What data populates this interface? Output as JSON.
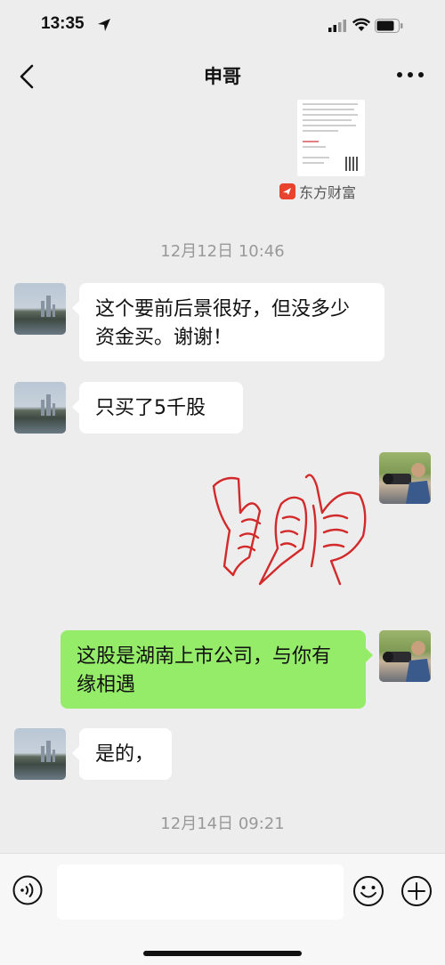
{
  "status_bar": {
    "time": "13:35"
  },
  "header": {
    "title": "申哥"
  },
  "shared_card": {
    "source": "东方财富"
  },
  "messages": [
    {
      "type": "timestamp",
      "text": "12月12日 10:46"
    },
    {
      "type": "text",
      "side": "left",
      "text": "这个要前后景很好，但没多少资金买。谢谢！"
    },
    {
      "type": "text",
      "side": "left",
      "text": "只买了5千股"
    },
    {
      "type": "sticker",
      "side": "right",
      "icon": "thumbs-up-sticker-icon"
    },
    {
      "type": "text",
      "side": "right",
      "text": "这股是湖南上市公司，与你有缘相遇"
    },
    {
      "type": "text",
      "side": "left",
      "text": "是的，"
    },
    {
      "type": "timestamp",
      "text": "12月14日 09:21"
    }
  ],
  "input_bar": {
    "placeholder": ""
  },
  "colors": {
    "background": "#ededed",
    "outgoing_bubble": "#95ec69",
    "incoming_bubble": "#ffffff",
    "sticker_red": "#d22a2a"
  }
}
